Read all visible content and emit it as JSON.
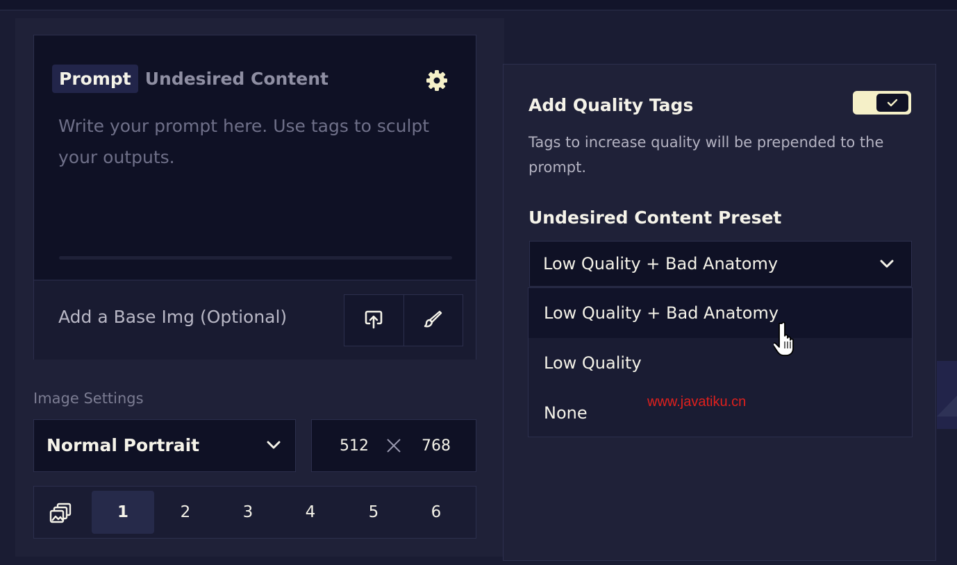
{
  "prompt_panel": {
    "tabs": [
      "Prompt",
      "Undesired Content"
    ],
    "active_tab": "Prompt",
    "settings_icon": "gear-icon",
    "placeholder": "Write your prompt here. Use tags to sculpt your outputs."
  },
  "base_image": {
    "label": "Add a Base Img (Optional)",
    "upload_icon": "upload-icon",
    "paint_icon": "brush-icon"
  },
  "image_settings": {
    "heading": "Image Settings",
    "preset": "Normal Portrait",
    "width": "512",
    "height": "768",
    "count_icon": "images-stack-icon",
    "counts": [
      "1",
      "2",
      "3",
      "4",
      "5",
      "6"
    ],
    "selected_count": "1"
  },
  "quality": {
    "title": "Add Quality Tags",
    "enabled": true,
    "description": "Tags to increase quality will be prepended to the prompt."
  },
  "undesired_preset": {
    "title": "Undesired Content Preset",
    "selected": "Low Quality + Bad Anatomy",
    "options": [
      "Low Quality + Bad Anatomy",
      "Low Quality",
      "None"
    ],
    "hovered": "Low Quality + Bad Anatomy"
  },
  "watermark": "www.javatiku.cn",
  "colors": {
    "background": "#1a1c33",
    "panel": "#1f2138",
    "input": "#0f1125",
    "border": "#2c2f4d",
    "accent": "#f5f0c8",
    "watermark": "#e0201d"
  }
}
